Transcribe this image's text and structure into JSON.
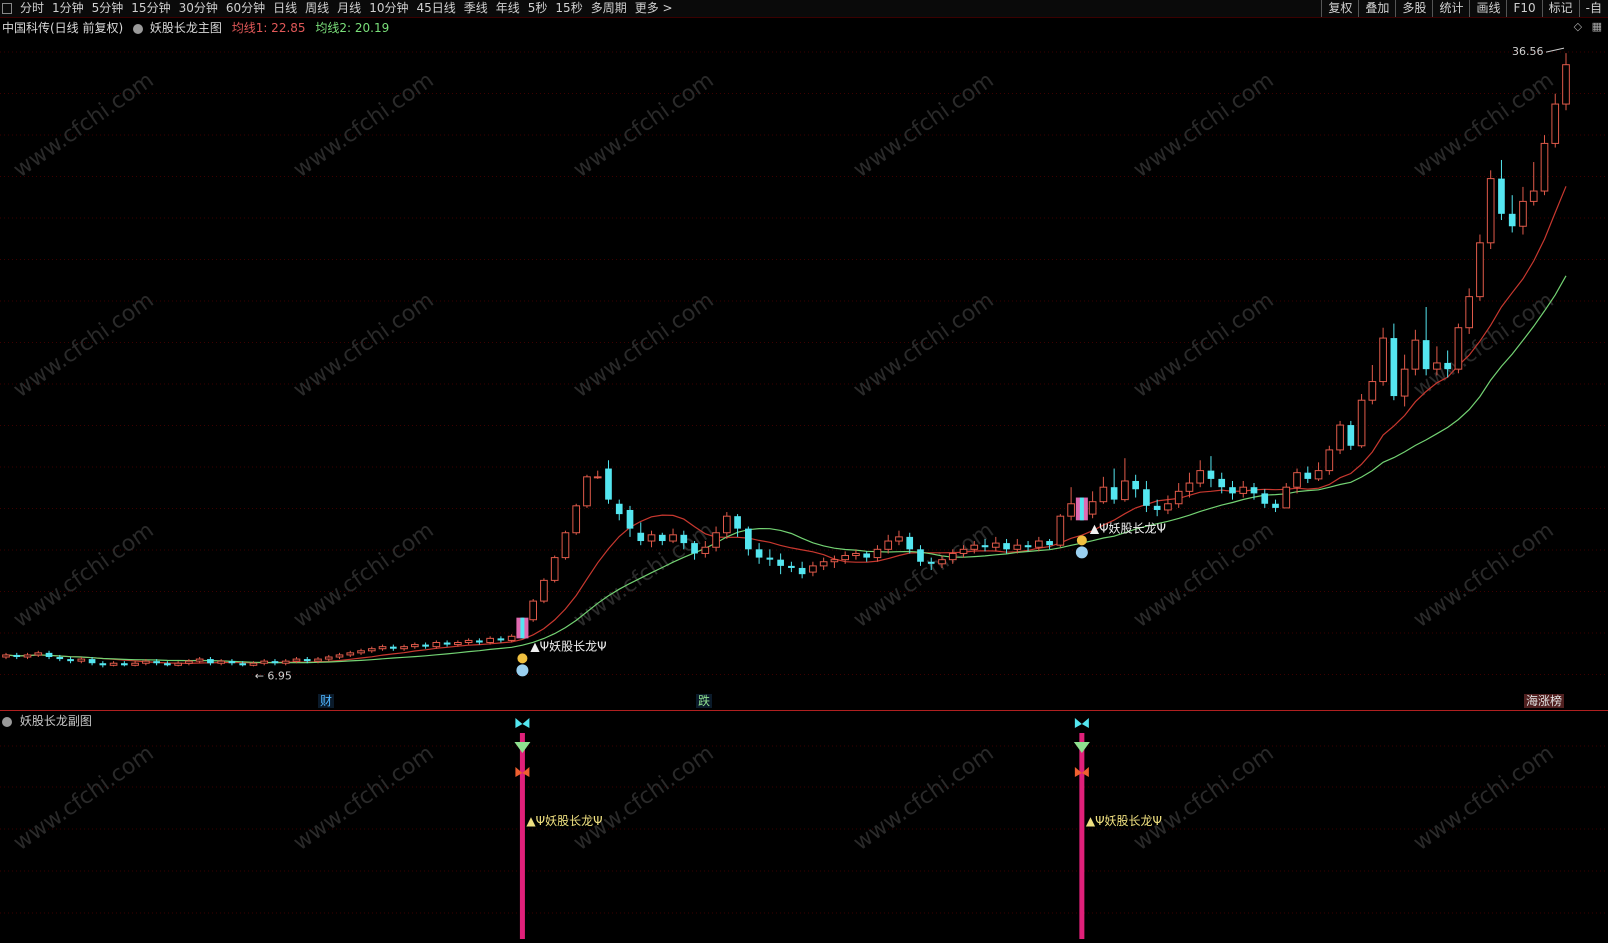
{
  "toolbar": {
    "periods": [
      "分时",
      "1分钟",
      "5分钟",
      "15分钟",
      "30分钟",
      "60分钟",
      "日线",
      "周线",
      "月线",
      "10分钟",
      "45日线",
      "季线",
      "年线",
      "5秒",
      "15秒",
      "多周期",
      "更多 >"
    ],
    "right_buttons": [
      "复权",
      "叠加",
      "多股",
      "统计",
      "画线",
      "F10",
      "标记",
      "-自"
    ]
  },
  "header": {
    "stock": "中国科传(日线 前复权)",
    "indicator": "妖股长龙主图",
    "ma1": "均线1: 22.85",
    "ma2": "均线2: 20.19"
  },
  "main_chart": {
    "high_label": "36.56",
    "low_label": "6.95",
    "signal_label": "Ψ妖股长龙Ψ",
    "events": [
      "财",
      "跌",
      "海涨榜"
    ],
    "watermark": "www.cfchi.com",
    "colors": {
      "up": "#e05a4a",
      "down": "#54e6f0",
      "ma1": "#c8382f",
      "ma2": "#73d273",
      "grid": "#7a0000"
    }
  },
  "sub_panel": {
    "title": "妖股长龙副图",
    "signal_label": "Ψ妖股长龙Ψ",
    "colors": {
      "bar": "#e0207a",
      "signal": "#f0e080"
    }
  },
  "chart_data": {
    "type": "candlestick",
    "title": "妖股长龙主图",
    "price_high": 36.56,
    "price_low": 6.95,
    "series": [
      {
        "name": "均线1",
        "last": 22.85
      },
      {
        "name": "均线2",
        "last": 20.19
      }
    ],
    "candles": [
      [
        7.4,
        7.5,
        7.6,
        7.3
      ],
      [
        7.5,
        7.4,
        7.6,
        7.3
      ],
      [
        7.4,
        7.5,
        7.6,
        7.3
      ],
      [
        7.5,
        7.6,
        7.7,
        7.4
      ],
      [
        7.6,
        7.4,
        7.7,
        7.3
      ],
      [
        7.4,
        7.3,
        7.5,
        7.2
      ],
      [
        7.3,
        7.2,
        7.4,
        7.1
      ],
      [
        7.2,
        7.3,
        7.4,
        7.1
      ],
      [
        7.3,
        7.1,
        7.4,
        7.0
      ],
      [
        7.1,
        7.0,
        7.2,
        6.9
      ],
      [
        7.0,
        7.1,
        7.2,
        6.95
      ],
      [
        7.1,
        7.0,
        7.2,
        6.95
      ],
      [
        7.0,
        7.1,
        7.2,
        6.95
      ],
      [
        7.1,
        7.2,
        7.3,
        7.0
      ],
      [
        7.2,
        7.1,
        7.3,
        7.0
      ],
      [
        7.1,
        7.0,
        7.2,
        6.95
      ],
      [
        7.0,
        7.1,
        7.2,
        6.95
      ],
      [
        7.1,
        7.2,
        7.3,
        7.0
      ],
      [
        7.2,
        7.3,
        7.4,
        7.1
      ],
      [
        7.3,
        7.1,
        7.4,
        7.0
      ],
      [
        7.1,
        7.2,
        7.3,
        7.0
      ],
      [
        7.2,
        7.1,
        7.3,
        7.0
      ],
      [
        7.1,
        7.0,
        7.2,
        6.95
      ],
      [
        7.0,
        7.1,
        7.2,
        6.95
      ],
      [
        7.1,
        7.2,
        7.3,
        7.0
      ],
      [
        7.2,
        7.1,
        7.3,
        7.0
      ],
      [
        7.1,
        7.2,
        7.3,
        7.0
      ],
      [
        7.2,
        7.3,
        7.4,
        7.1
      ],
      [
        7.3,
        7.2,
        7.4,
        7.1
      ],
      [
        7.2,
        7.3,
        7.4,
        7.1
      ],
      [
        7.3,
        7.4,
        7.5,
        7.2
      ],
      [
        7.4,
        7.5,
        7.6,
        7.3
      ],
      [
        7.5,
        7.6,
        7.7,
        7.4
      ],
      [
        7.6,
        7.7,
        7.8,
        7.5
      ],
      [
        7.7,
        7.8,
        7.9,
        7.6
      ],
      [
        7.8,
        7.9,
        8.0,
        7.7
      ],
      [
        7.9,
        7.8,
        8.0,
        7.7
      ],
      [
        7.8,
        7.9,
        8.0,
        7.7
      ],
      [
        7.9,
        8.0,
        8.1,
        7.8
      ],
      [
        8.0,
        7.9,
        8.1,
        7.8
      ],
      [
        7.9,
        8.1,
        8.2,
        7.8
      ],
      [
        8.1,
        8.0,
        8.2,
        7.9
      ],
      [
        8.0,
        8.1,
        8.2,
        7.9
      ],
      [
        8.1,
        8.2,
        8.3,
        8.0
      ],
      [
        8.2,
        8.1,
        8.3,
        8.0
      ],
      [
        8.1,
        8.3,
        8.4,
        8.0
      ],
      [
        8.3,
        8.2,
        8.4,
        8.1
      ],
      [
        8.2,
        8.4,
        8.5,
        8.1
      ],
      [
        8.4,
        9.2,
        9.3,
        8.3
      ],
      [
        9.2,
        10.1,
        10.2,
        9.1
      ],
      [
        10.1,
        11.1,
        11.2,
        10.0
      ],
      [
        11.1,
        12.2,
        12.3,
        11.0
      ],
      [
        12.2,
        13.4,
        13.5,
        12.1
      ],
      [
        13.4,
        14.7,
        14.8,
        13.3
      ],
      [
        14.7,
        16.1,
        16.2,
        14.6
      ],
      [
        16.1,
        16.1,
        16.4,
        16.0
      ],
      [
        16.5,
        15.0,
        16.9,
        14.8
      ],
      [
        14.8,
        14.3,
        15.0,
        14.0
      ],
      [
        14.5,
        13.6,
        14.7,
        13.2
      ],
      [
        13.4,
        13.0,
        13.9,
        12.8
      ],
      [
        13.0,
        13.3,
        13.5,
        12.7
      ],
      [
        13.3,
        13.0,
        13.4,
        12.8
      ],
      [
        13.0,
        13.3,
        13.6,
        12.9
      ],
      [
        13.3,
        12.9,
        13.5,
        12.6
      ],
      [
        12.9,
        12.4,
        13.0,
        12.1
      ],
      [
        12.4,
        12.7,
        13.0,
        12.2
      ],
      [
        12.7,
        13.4,
        13.7,
        12.5
      ],
      [
        13.4,
        14.2,
        14.4,
        13.1
      ],
      [
        14.2,
        13.6,
        14.3,
        13.2
      ],
      [
        13.6,
        12.6,
        13.7,
        12.3
      ],
      [
        12.6,
        12.2,
        12.9,
        11.9
      ],
      [
        12.2,
        12.1,
        12.6,
        11.8
      ],
      [
        12.1,
        11.8,
        12.4,
        11.4
      ],
      [
        11.8,
        11.7,
        12.0,
        11.5
      ],
      [
        11.7,
        11.4,
        12.0,
        11.2
      ],
      [
        11.5,
        11.8,
        12.0,
        11.3
      ],
      [
        11.8,
        12.0,
        12.2,
        11.6
      ],
      [
        12.0,
        12.1,
        12.3,
        11.7
      ],
      [
        12.1,
        12.3,
        12.5,
        11.9
      ],
      [
        12.3,
        12.4,
        12.6,
        12.1
      ],
      [
        12.4,
        12.2,
        12.5,
        12.0
      ],
      [
        12.2,
        12.6,
        12.8,
        12.0
      ],
      [
        12.6,
        13.0,
        13.3,
        12.4
      ],
      [
        13.0,
        13.2,
        13.5,
        12.8
      ],
      [
        13.2,
        12.6,
        13.4,
        12.4
      ],
      [
        12.6,
        12.0,
        12.8,
        11.8
      ],
      [
        12.0,
        11.9,
        12.2,
        11.6
      ],
      [
        11.9,
        12.1,
        12.3,
        11.7
      ],
      [
        12.1,
        12.4,
        12.6,
        11.9
      ],
      [
        12.4,
        12.6,
        12.8,
        12.2
      ],
      [
        12.6,
        12.8,
        13.0,
        12.4
      ],
      [
        12.8,
        12.7,
        13.1,
        12.5
      ],
      [
        12.7,
        12.9,
        13.2,
        12.5
      ],
      [
        12.9,
        12.6,
        13.1,
        12.4
      ],
      [
        12.6,
        12.8,
        13.1,
        12.4
      ],
      [
        12.8,
        12.7,
        13.0,
        12.5
      ],
      [
        12.7,
        13.0,
        13.2,
        12.5
      ],
      [
        13.0,
        12.8,
        13.1,
        12.6
      ],
      [
        12.8,
        14.2,
        14.3,
        12.7
      ],
      [
        14.2,
        14.8,
        15.6,
        14.0
      ],
      [
        14.8,
        14.3,
        15.1,
        14.0
      ],
      [
        14.3,
        14.9,
        15.4,
        14.1
      ],
      [
        14.9,
        15.6,
        16.1,
        14.8
      ],
      [
        15.6,
        15.0,
        16.5,
        14.8
      ],
      [
        15.0,
        15.9,
        17.0,
        14.9
      ],
      [
        15.9,
        15.5,
        16.2,
        15.1
      ],
      [
        15.5,
        14.7,
        15.9,
        14.4
      ],
      [
        14.7,
        14.5,
        15.0,
        14.2
      ],
      [
        14.5,
        14.8,
        15.2,
        14.3
      ],
      [
        14.8,
        15.4,
        15.8,
        14.6
      ],
      [
        15.4,
        15.8,
        16.3,
        15.1
      ],
      [
        15.8,
        16.4,
        16.9,
        15.6
      ],
      [
        16.4,
        16.0,
        17.1,
        15.6
      ],
      [
        16.0,
        15.6,
        16.3,
        15.3
      ],
      [
        15.6,
        15.3,
        15.9,
        15.0
      ],
      [
        15.3,
        15.6,
        15.9,
        15.1
      ],
      [
        15.6,
        15.3,
        15.8,
        15.0
      ],
      [
        15.3,
        14.8,
        15.5,
        14.6
      ],
      [
        14.8,
        14.6,
        15.0,
        14.4
      ],
      [
        14.6,
        15.6,
        15.8,
        14.6
      ],
      [
        15.6,
        16.3,
        16.5,
        15.3
      ],
      [
        16.3,
        16.0,
        16.6,
        15.8
      ],
      [
        16.0,
        16.4,
        16.8,
        15.9
      ],
      [
        16.4,
        17.4,
        17.6,
        16.2
      ],
      [
        17.4,
        18.6,
        18.8,
        17.2
      ],
      [
        18.6,
        17.6,
        18.8,
        17.4
      ],
      [
        17.6,
        19.8,
        20.1,
        17.5
      ],
      [
        19.8,
        20.7,
        21.5,
        19.6
      ],
      [
        20.7,
        22.8,
        23.3,
        20.5
      ],
      [
        22.8,
        20.0,
        23.5,
        19.8
      ],
      [
        20.0,
        21.3,
        22.0,
        19.5
      ],
      [
        21.3,
        22.7,
        23.2,
        21.0
      ],
      [
        22.7,
        21.3,
        24.3,
        21.0
      ],
      [
        21.3,
        21.6,
        22.4,
        21.0
      ],
      [
        21.6,
        21.3,
        22.2,
        20.9
      ],
      [
        21.3,
        23.3,
        23.5,
        21.1
      ],
      [
        23.3,
        24.8,
        25.2,
        23.0
      ],
      [
        24.8,
        27.4,
        27.8,
        24.6
      ],
      [
        27.4,
        30.5,
        30.9,
        27.1
      ],
      [
        30.5,
        28.8,
        31.4,
        28.5
      ],
      [
        28.8,
        28.2,
        29.7,
        27.9
      ],
      [
        28.2,
        29.4,
        30.1,
        27.8
      ],
      [
        29.4,
        29.9,
        31.3,
        29.2
      ],
      [
        29.9,
        32.2,
        32.6,
        29.7
      ],
      [
        32.2,
        34.1,
        34.6,
        32.0
      ],
      [
        34.1,
        36.0,
        36.56,
        33.8
      ]
    ]
  }
}
